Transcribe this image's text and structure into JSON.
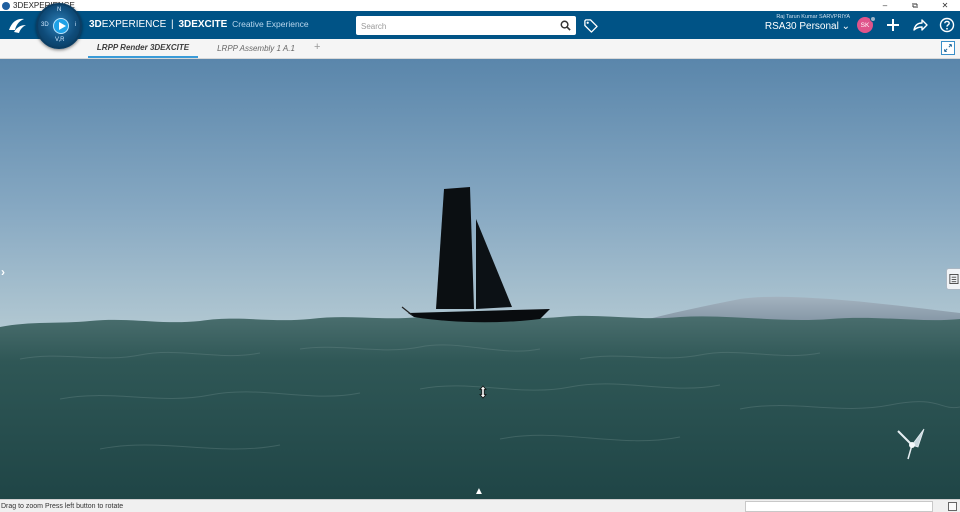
{
  "window": {
    "title": "3DEXPERIENCE",
    "controls": [
      "–",
      "⧉",
      "✕"
    ]
  },
  "compass": {
    "top": "N",
    "left": "3D",
    "right": "i",
    "bottom": "V,R"
  },
  "brand": {
    "prefix_bold": "3D",
    "prefix_rest": "EXPERIENCE",
    "separator": "|",
    "app_name": "3DEXCITE",
    "app_subtitle": "Creative Experience"
  },
  "search": {
    "placeholder": "Search"
  },
  "user": {
    "name": "Raj Tarun Kumar SARVPRIYA",
    "context": "RSA30 Personal",
    "initials": "SK"
  },
  "tabs": [
    {
      "label": "LRPP Render 3DEXCITE",
      "active": true
    },
    {
      "label": "LRPP Assembly 1 A.1",
      "active": false
    }
  ],
  "tab_add": "+",
  "status": {
    "message": "Drag to zoom  Press left button to rotate"
  },
  "colors": {
    "topbar": "#005386",
    "accent": "#3a9bd8",
    "avatar": "#e0548b",
    "sky_top": "#5d88ac",
    "sky_horizon": "#a6bfcc",
    "sea": "#2d5555"
  },
  "icons": [
    "search-icon",
    "tag-icon",
    "plus-icon",
    "share-icon",
    "help-icon",
    "expand-icon",
    "chevron-right-icon",
    "panel-icon",
    "move-cursor-icon",
    "chevron-up-icon",
    "compass-mini-icon"
  ]
}
